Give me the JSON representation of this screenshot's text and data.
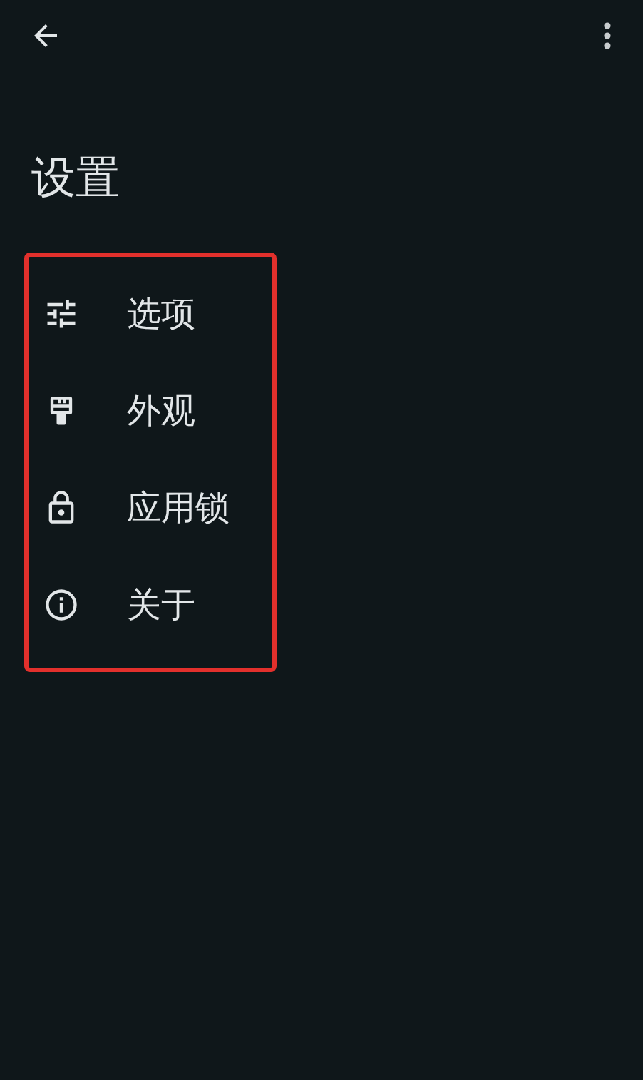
{
  "title": "设置",
  "menu_items": [
    {
      "kind": "tune",
      "label": "选项"
    },
    {
      "kind": "brush",
      "label": "外观"
    },
    {
      "kind": "lock",
      "label": "应用锁"
    },
    {
      "kind": "info",
      "label": "关于"
    }
  ]
}
